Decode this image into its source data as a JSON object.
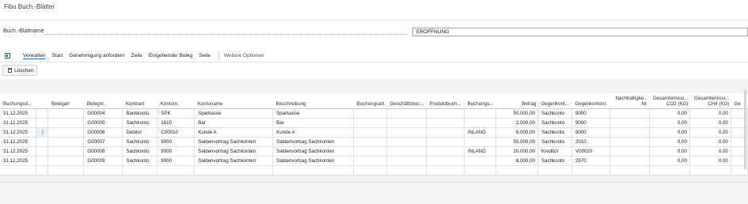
{
  "page": {
    "title": "Fibu Buch.-Blätter"
  },
  "batch_field": {
    "label": "Buch.-Blattname",
    "value": "ERÖFFNUNG"
  },
  "actions": {
    "items": [
      "Verwalten",
      "Start",
      "Genehmigung anfordern",
      "Zeile",
      "Eingehender Beleg",
      "Seite"
    ],
    "more": "Weitere Optionen",
    "delete_label": "Löschen"
  },
  "table": {
    "columns": [
      "Buchungsd...",
      "",
      "Belegart",
      "Belegnr.",
      "Kontoart",
      "Kontonr.",
      "Kontoname",
      "Beschreibung",
      "Buchungsart",
      "Geschäftsbuc...",
      "Produktbuch...",
      "Buchungs...",
      "Betrag",
      "Gegenkont...",
      "Gegenkontonr.",
      "Nachhaltigke... Nr.",
      "Gesamtemissi... CO2 (KG)",
      "Gesamtemissi... CH4 (KG)",
      "Ge"
    ],
    "rows": [
      [
        "31.12.2025",
        "",
        "",
        "G00004",
        "Bankkonto",
        "SPK",
        "Sparkasse",
        "Sparkasse",
        "",
        "",
        "",
        "",
        "50.000,00",
        "Sachkonto",
        "9000",
        "",
        "0,00",
        "0,00",
        ""
      ],
      [
        "31.12.2025",
        "",
        "",
        "G00005",
        "Sachkonto",
        "1610",
        "Bar",
        "Bar",
        "",
        "",
        "",
        "",
        "2.000,00",
        "Sachkonto",
        "9000",
        "",
        "0,00",
        "0,00",
        ""
      ],
      [
        "31.12.2025",
        "⋮",
        "",
        "G00006",
        "Debitor",
        "C00010",
        "Kunde A",
        "Kunde A",
        "",
        "",
        "",
        "INLAND",
        "8.000,00",
        "Sachkonto",
        "9000",
        "",
        "0,00",
        "0,00",
        ""
      ],
      [
        "31.12.2025",
        "",
        "",
        "G00007",
        "Sachkonto",
        "9000",
        "Saldenvortrag Sachkonten",
        "Saldenvortrag Sachkonten",
        "",
        "",
        "",
        "",
        "50.000,00",
        "Sachkonto",
        "2010",
        "",
        "0,00",
        "0,00",
        ""
      ],
      [
        "31.12.2025",
        "",
        "",
        "G00008",
        "Sachkonto",
        "9000",
        "Saldenvortrag Sachkonten",
        "Saldenvortrag Sachkonten",
        "",
        "",
        "",
        "INLAND",
        "20.000,00",
        "Kreditor",
        "V00020",
        "",
        "0,00",
        "0,00",
        ""
      ],
      [
        "31.12.2025",
        "",
        "",
        "G00009",
        "Sachkonto",
        "9000",
        "Saldenvortrag Sachkonten",
        "Saldenvortrag Sachkonten",
        "",
        "",
        "",
        "",
        "8.000,00",
        "Sachkonto",
        "2970",
        "",
        "0,00",
        "0,00",
        ""
      ]
    ]
  },
  "icons": {
    "action_icon": "view-icon",
    "delete_icon": "trash-icon",
    "row_menu": "vertical-dots-icon"
  },
  "colors": {
    "accent": "#0f6cbd"
  }
}
